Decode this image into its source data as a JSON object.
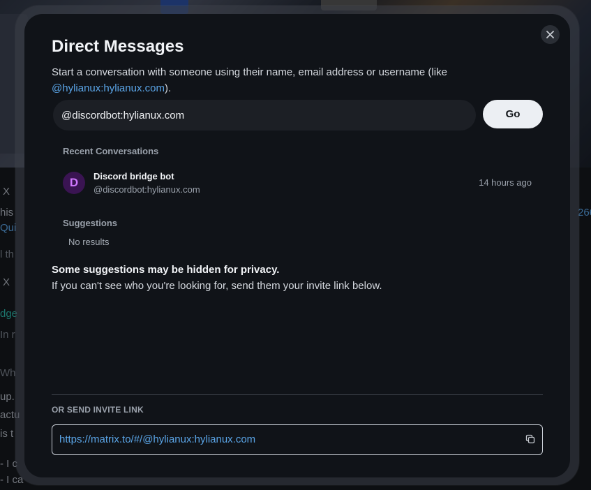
{
  "background": {
    "fragments": [
      {
        "text": "X",
        "cls": ""
      },
      {
        "text": "his",
        "cls": ""
      },
      {
        "text": "Qui",
        "cls": "link"
      },
      {
        "text": "l th",
        "cls": "dim"
      },
      {
        "text": "X",
        "cls": ""
      },
      {
        "text": "dge",
        "cls": "teal"
      },
      {
        "text": "In r",
        "cls": "dim"
      },
      {
        "text": "Wh",
        "cls": "dim"
      },
      {
        "text": "up.",
        "cls": ""
      },
      {
        "text": "actu",
        "cls": ""
      },
      {
        "text": "is t",
        "cls": ""
      },
      {
        "text": "- I c",
        "cls": ""
      },
      {
        "text": "- I ca",
        "cls": ""
      },
      {
        "text": "266",
        "cls": "link"
      }
    ]
  },
  "dialog": {
    "title": "Direct Messages",
    "subtitle_prefix": "Start a conversation with someone using their name, email address or username (like ",
    "subtitle_link": "@hylianux:hylianux.com",
    "subtitle_suffix": ").",
    "close_icon": "close-icon",
    "search": {
      "value": "@discordbot:hylianux.com",
      "placeholder": ""
    },
    "go_label": "Go",
    "recent": {
      "label": "Recent Conversations",
      "items": [
        {
          "avatar_letter": "D",
          "name": "Discord bridge bot",
          "id": "@discordbot:hylianux.com",
          "time": "14 hours ago"
        }
      ]
    },
    "suggestions": {
      "label": "Suggestions",
      "empty": "No results"
    },
    "privacy": {
      "title": "Some suggestions may be hidden for privacy.",
      "body": "If you can't see who you're looking for, send them your invite link below."
    },
    "invite": {
      "label": "OR SEND INVITE LINK",
      "link": "https://matrix.to/#/@hylianux:hylianux.com",
      "copy_icon": "copy-icon"
    }
  },
  "colors": {
    "accent_link": "#5aa4e6",
    "avatar_bg": "#3a1452",
    "avatar_fg": "#d078ff"
  }
}
